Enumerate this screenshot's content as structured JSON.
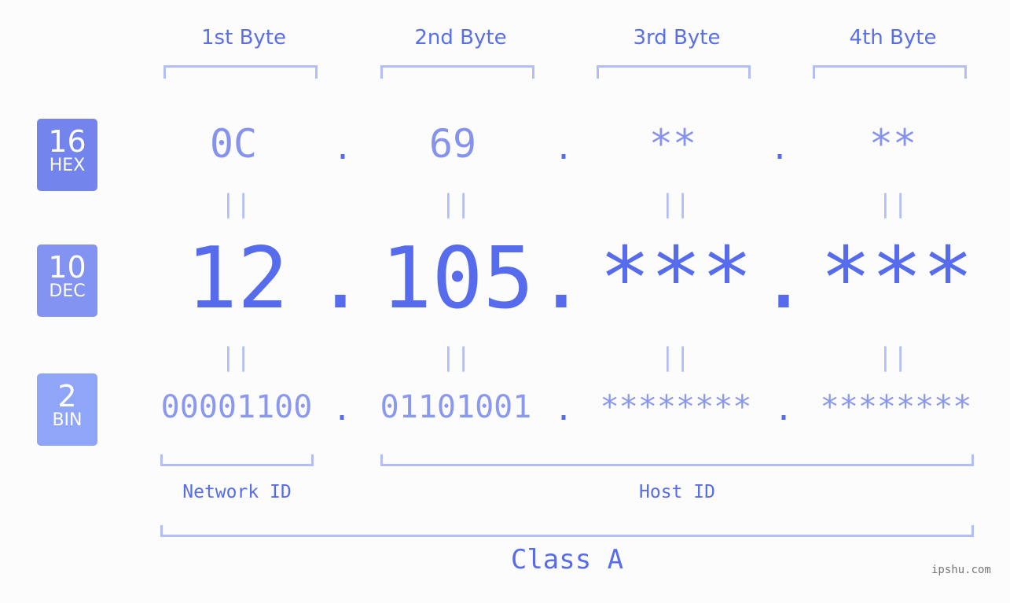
{
  "headers": [
    "1st Byte",
    "2nd Byte",
    "3rd Byte",
    "4th Byte"
  ],
  "badges": {
    "hex": {
      "num": "16",
      "label": "HEX",
      "color": "#7384ec"
    },
    "dec": {
      "num": "10",
      "label": "DEC",
      "color": "#8393f1"
    },
    "bin": {
      "num": "2",
      "label": "BIN",
      "color": "#8ea5f8"
    }
  },
  "hex": [
    "0C",
    "69",
    "**",
    "**"
  ],
  "dec": [
    "12",
    "105",
    "***",
    "***"
  ],
  "bin": [
    "00001100",
    "01101001",
    "********",
    "********"
  ],
  "separator": ".",
  "equals": "||",
  "network_id_label": "Network ID",
  "host_id_label": "Host ID",
  "class_label": "Class A",
  "watermark": "ipshu.com"
}
